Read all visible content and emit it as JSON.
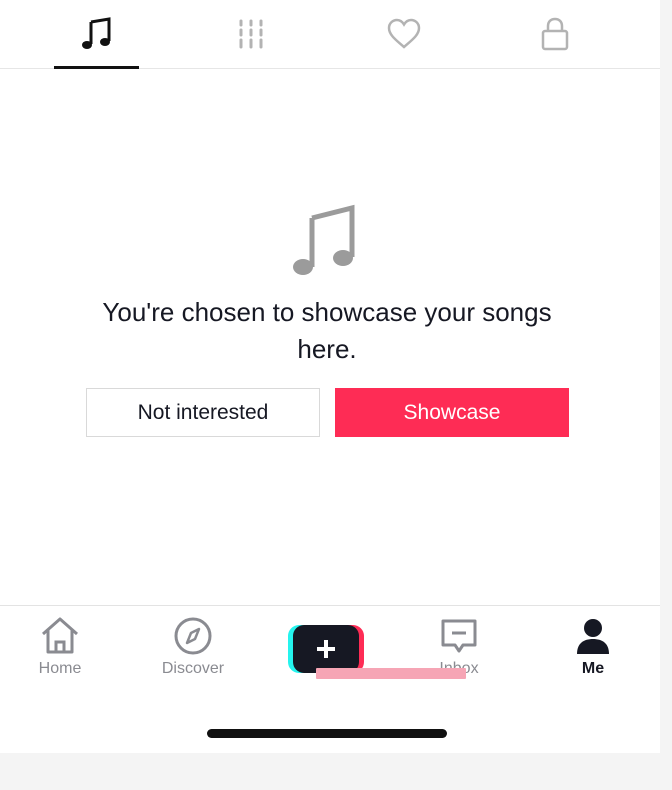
{
  "top_tabs": [
    {
      "icon": "music-note-icon",
      "active": true
    },
    {
      "icon": "grid-icon",
      "active": false
    },
    {
      "icon": "heart-icon",
      "active": false
    },
    {
      "icon": "lock-icon",
      "active": false
    }
  ],
  "empty_state": {
    "icon": "music-note-icon",
    "message": "You're chosen to showcase your songs here."
  },
  "buttons": {
    "not_interested": "Not interested",
    "showcase": "Showcase"
  },
  "bottom_nav": {
    "home": "Home",
    "discover": "Discover",
    "create_icon": "plus-icon",
    "inbox": "Inbox",
    "me": "Me"
  },
  "colors": {
    "accent": "#fe2c55",
    "cyan": "#25f4ee",
    "dark": "#161823"
  }
}
